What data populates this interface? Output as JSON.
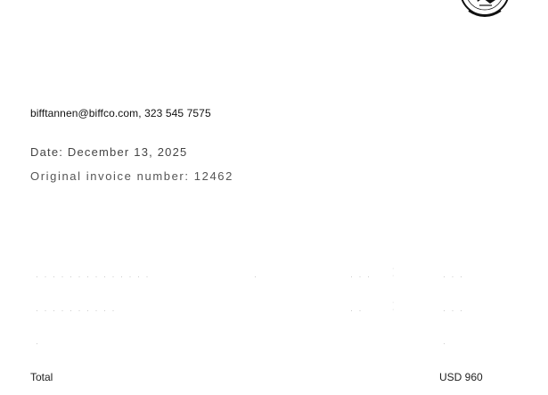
{
  "document": {
    "contact_line": "bifftannen@biffco.com, 323 545 7575",
    "date": "Date: December 13, 2025",
    "original_invoice": "Original invoice number: 12462",
    "line_items": [
      {
        "description": "· · · · · · ·  · · · · · · ·",
        "mark": "·",
        "quantity": "· · ·",
        "separator": "·\n·",
        "amount": "· · ·"
      },
      {
        "description": "· · · · · ·  · · · ·",
        "mark": "",
        "quantity": "· ·",
        "separator": "·\n·",
        "amount": "· · ·"
      },
      {
        "description": "·",
        "mark": "",
        "quantity": "",
        "separator": "",
        "amount": "·"
      }
    ],
    "total_label": "Total",
    "total_value": "USD 960"
  },
  "colors": {
    "text": "#111111",
    "faded_text": "#c4c4c4"
  },
  "icons": {
    "logo": "seal-logo-icon"
  }
}
